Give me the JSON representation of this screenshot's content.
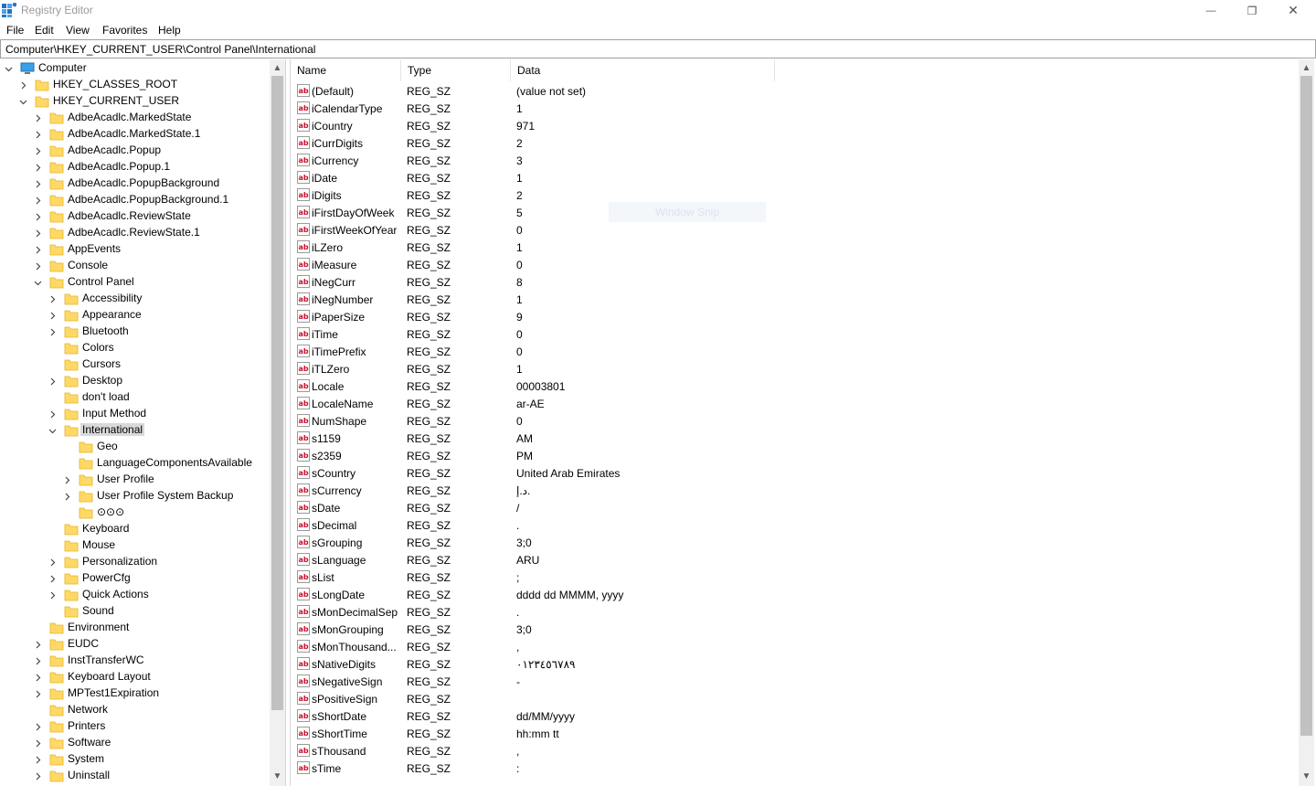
{
  "window": {
    "title": "Registry Editor",
    "minimize": "—",
    "restore": "❐",
    "close": "✕"
  },
  "menu": [
    "File",
    "Edit",
    "View",
    "Favorites",
    "Help"
  ],
  "address": "Computer\\HKEY_CURRENT_USER\\Control Panel\\International",
  "colors": {
    "folder": "#ffd966",
    "folder_dark": "#e6b422",
    "selected_bg": "#d9d9d9",
    "ab_icon_red": "#c8102e"
  },
  "tree": [
    {
      "label": "Computer",
      "icon": "computer-icon",
      "expander": "expanded"
    },
    {
      "label": "HKEY_CLASSES_ROOT",
      "expander": "collapsed"
    },
    {
      "label": "HKEY_CURRENT_USER",
      "expander": "expanded"
    },
    {
      "label": "AdbeAcadlc.MarkedState",
      "expander": "collapsed"
    },
    {
      "label": "AdbeAcadlc.MarkedState.1",
      "expander": "collapsed"
    },
    {
      "label": "AdbeAcadlc.Popup",
      "expander": "collapsed"
    },
    {
      "label": "AdbeAcadlc.Popup.1",
      "expander": "collapsed"
    },
    {
      "label": "AdbeAcadlc.PopupBackground",
      "expander": "collapsed"
    },
    {
      "label": "AdbeAcadlc.PopupBackground.1",
      "expander": "collapsed"
    },
    {
      "label": "AdbeAcadlc.ReviewState",
      "expander": "collapsed"
    },
    {
      "label": "AdbeAcadlc.ReviewState.1",
      "expander": "collapsed"
    },
    {
      "label": "AppEvents",
      "expander": "collapsed"
    },
    {
      "label": "Console",
      "expander": "collapsed"
    },
    {
      "label": "Control Panel",
      "expander": "expanded"
    },
    {
      "label": "Accessibility",
      "expander": "collapsed"
    },
    {
      "label": "Appearance",
      "expander": "collapsed"
    },
    {
      "label": "Bluetooth",
      "expander": "collapsed"
    },
    {
      "label": "Colors",
      "expander": "none"
    },
    {
      "label": "Cursors",
      "expander": "none"
    },
    {
      "label": "Desktop",
      "expander": "collapsed"
    },
    {
      "label": "don't load",
      "expander": "none"
    },
    {
      "label": "Input Method",
      "expander": "collapsed"
    },
    {
      "label": "International",
      "expander": "expanded",
      "selected": true
    },
    {
      "label": "Geo",
      "expander": "none"
    },
    {
      "label": "LanguageComponentsAvailable",
      "expander": "none"
    },
    {
      "label": "User Profile",
      "expander": "collapsed"
    },
    {
      "label": "User Profile System Backup",
      "expander": "collapsed"
    },
    {
      "label": "⊙⊙⊙",
      "expander": "none"
    },
    {
      "label": "Keyboard",
      "expander": "none"
    },
    {
      "label": "Mouse",
      "expander": "none"
    },
    {
      "label": "Personalization",
      "expander": "collapsed"
    },
    {
      "label": "PowerCfg",
      "expander": "collapsed"
    },
    {
      "label": "Quick Actions",
      "expander": "collapsed"
    },
    {
      "label": "Sound",
      "expander": "none"
    },
    {
      "label": "Environment",
      "expander": "none"
    },
    {
      "label": "EUDC",
      "expander": "collapsed"
    },
    {
      "label": "InstTransferWC",
      "expander": "collapsed"
    },
    {
      "label": "Keyboard Layout",
      "expander": "collapsed"
    },
    {
      "label": "MPTest1Expiration",
      "expander": "collapsed"
    },
    {
      "label": "Network",
      "expander": "none"
    },
    {
      "label": "Printers",
      "expander": "collapsed"
    },
    {
      "label": "Software",
      "expander": "collapsed"
    },
    {
      "label": "System",
      "expander": "collapsed"
    },
    {
      "label": "Uninstall",
      "expander": "collapsed"
    }
  ],
  "columns": {
    "name": "Name",
    "type": "Type",
    "data": "Data"
  },
  "values": [
    {
      "name": "(Default)",
      "type": "REG_SZ",
      "data": "(value not set)"
    },
    {
      "name": "iCalendarType",
      "type": "REG_SZ",
      "data": "1"
    },
    {
      "name": "iCountry",
      "type": "REG_SZ",
      "data": "971"
    },
    {
      "name": "iCurrDigits",
      "type": "REG_SZ",
      "data": "2"
    },
    {
      "name": "iCurrency",
      "type": "REG_SZ",
      "data": "3"
    },
    {
      "name": "iDate",
      "type": "REG_SZ",
      "data": "1"
    },
    {
      "name": "iDigits",
      "type": "REG_SZ",
      "data": "2"
    },
    {
      "name": "iFirstDayOfWeek",
      "type": "REG_SZ",
      "data": "5"
    },
    {
      "name": "iFirstWeekOfYear",
      "type": "REG_SZ",
      "data": "0"
    },
    {
      "name": "iLZero",
      "type": "REG_SZ",
      "data": "1"
    },
    {
      "name": "iMeasure",
      "type": "REG_SZ",
      "data": "0"
    },
    {
      "name": "iNegCurr",
      "type": "REG_SZ",
      "data": "8"
    },
    {
      "name": "iNegNumber",
      "type": "REG_SZ",
      "data": "1"
    },
    {
      "name": "iPaperSize",
      "type": "REG_SZ",
      "data": "9"
    },
    {
      "name": "iTime",
      "type": "REG_SZ",
      "data": "0"
    },
    {
      "name": "iTimePrefix",
      "type": "REG_SZ",
      "data": "0"
    },
    {
      "name": "iTLZero",
      "type": "REG_SZ",
      "data": "1"
    },
    {
      "name": "Locale",
      "type": "REG_SZ",
      "data": "00003801"
    },
    {
      "name": "LocaleName",
      "type": "REG_SZ",
      "data": "ar-AE"
    },
    {
      "name": "NumShape",
      "type": "REG_SZ",
      "data": "0"
    },
    {
      "name": "s1159",
      "type": "REG_SZ",
      "data": "AM"
    },
    {
      "name": "s2359",
      "type": "REG_SZ",
      "data": "PM"
    },
    {
      "name": "sCountry",
      "type": "REG_SZ",
      "data": "United Arab Emirates"
    },
    {
      "name": "sCurrency",
      "type": "REG_SZ",
      "data": "د.إ."
    },
    {
      "name": "sDate",
      "type": "REG_SZ",
      "data": "/"
    },
    {
      "name": "sDecimal",
      "type": "REG_SZ",
      "data": "."
    },
    {
      "name": "sGrouping",
      "type": "REG_SZ",
      "data": "3;0"
    },
    {
      "name": "sLanguage",
      "type": "REG_SZ",
      "data": "ARU"
    },
    {
      "name": "sList",
      "type": "REG_SZ",
      "data": ";"
    },
    {
      "name": "sLongDate",
      "type": "REG_SZ",
      "data": "dddd dd MMMM, yyyy"
    },
    {
      "name": "sMonDecimalSep",
      "type": "REG_SZ",
      "data": "."
    },
    {
      "name": "sMonGrouping",
      "type": "REG_SZ",
      "data": "3;0"
    },
    {
      "name": "sMonThousand...",
      "type": "REG_SZ",
      "data": ","
    },
    {
      "name": "sNativeDigits",
      "type": "REG_SZ",
      "data": "٠١٢٣٤٥٦٧٨٩"
    },
    {
      "name": "sNegativeSign",
      "type": "REG_SZ",
      "data": "-"
    },
    {
      "name": "sPositiveSign",
      "type": "REG_SZ",
      "data": ""
    },
    {
      "name": "sShortDate",
      "type": "REG_SZ",
      "data": "dd/MM/yyyy"
    },
    {
      "name": "sShortTime",
      "type": "REG_SZ",
      "data": "hh:mm tt"
    },
    {
      "name": "sThousand",
      "type": "REG_SZ",
      "data": ","
    },
    {
      "name": "sTime",
      "type": "REG_SZ",
      "data": ":"
    }
  ],
  "overlay": {
    "snip_label": "Window Snip"
  }
}
